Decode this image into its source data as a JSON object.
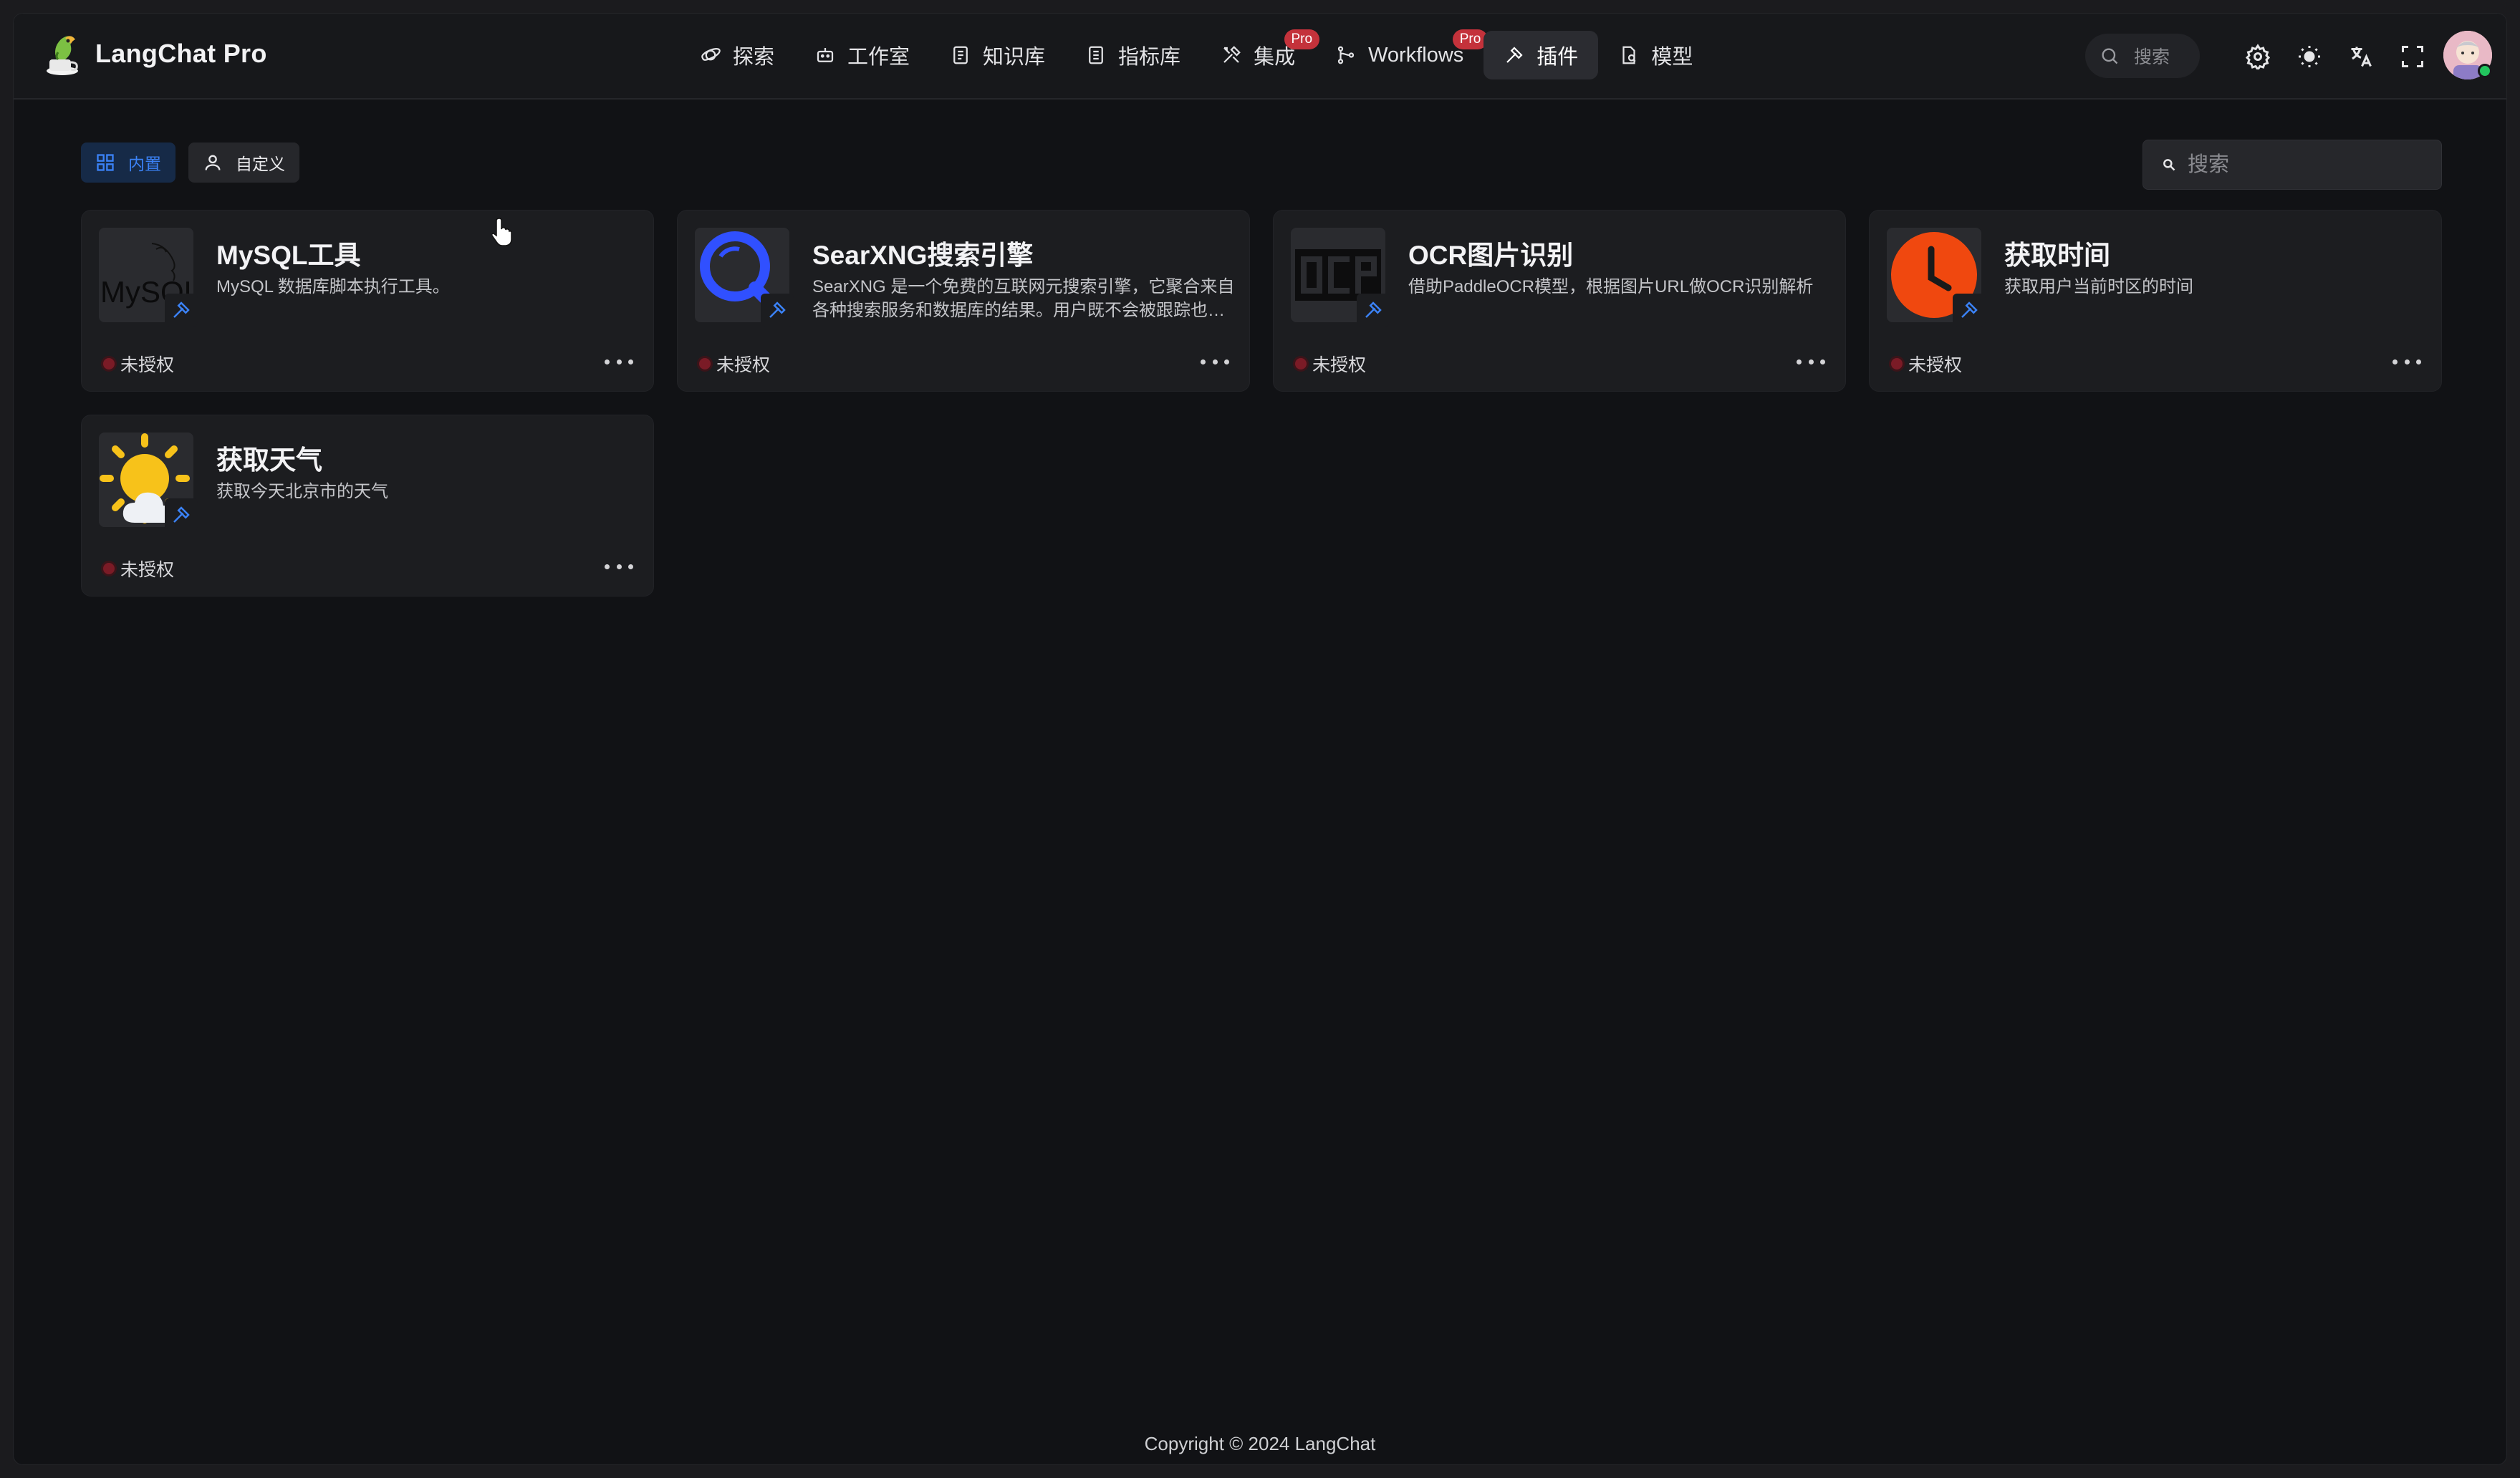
{
  "app": {
    "title": "LangChat Pro"
  },
  "nav": {
    "items": [
      {
        "label": "探索",
        "icon": "planet-icon"
      },
      {
        "label": "工作室",
        "icon": "robot-icon"
      },
      {
        "label": "知识库",
        "icon": "book-icon"
      },
      {
        "label": "指标库",
        "icon": "document-icon"
      },
      {
        "label": "集成",
        "icon": "tools-icon",
        "badge": "Pro"
      },
      {
        "label": "Workflows",
        "icon": "workflow-icon",
        "badge": "Pro"
      },
      {
        "label": "插件",
        "icon": "hammer-icon",
        "active": true
      },
      {
        "label": "模型",
        "icon": "file-model-icon"
      }
    ]
  },
  "header": {
    "search_placeholder": "搜索",
    "icons": [
      "settings-icon",
      "sun-icon",
      "translate-icon",
      "fullscreen-icon"
    ]
  },
  "tabs": [
    {
      "label": "内置",
      "icon": "grid-icon",
      "active": true
    },
    {
      "label": "自定义",
      "icon": "user-icon",
      "active": false
    }
  ],
  "search": {
    "placeholder": "搜索"
  },
  "plugins": [
    {
      "title": "MySQL工具",
      "description": "MySQL 数据库脚本执行工具。",
      "status": "未授权",
      "icon": "mysql-logo"
    },
    {
      "title": "SearXNG搜索引擎",
      "description": "SearXNG 是一个免费的互联网元搜索引擎，它聚合来自各种搜索服务和数据库的结果。用户既不会被跟踪也不会被分析。",
      "status": "未授权",
      "icon": "searxng-logo"
    },
    {
      "title": "OCR图片识别",
      "description": "借助PaddleOCR模型，根据图片URL做OCR识别解析",
      "status": "未授权",
      "icon": "ocr-logo"
    },
    {
      "title": "获取时间",
      "description": "获取用户当前时区的时间",
      "status": "未授权",
      "icon": "clock-logo"
    },
    {
      "title": "获取天气",
      "description": "获取今天北京市的天气",
      "status": "未授权",
      "icon": "weather-logo"
    }
  ],
  "footer": {
    "copyright": "Copyright © 2024 LangChat"
  },
  "colors": {
    "accent": "#3b82f6",
    "badge": "#c4323b",
    "status_dot": "#7a1b26",
    "bg": "#111215",
    "card": "#1c1d20"
  }
}
